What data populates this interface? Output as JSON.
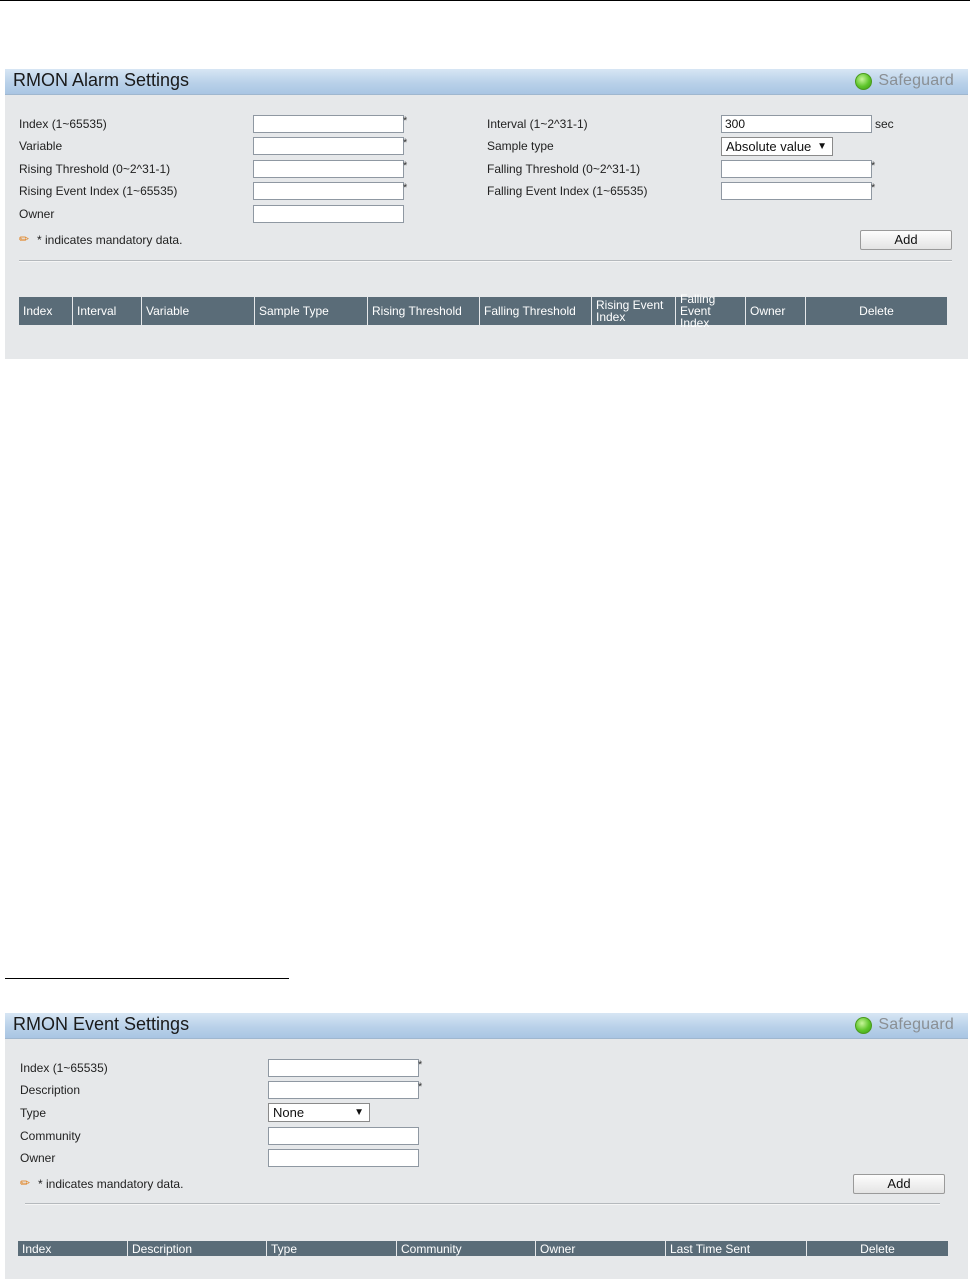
{
  "alarm": {
    "title": "RMON Alarm Settings",
    "safeguard": "Safeguard",
    "fields": {
      "index_label": "Index (1~65535)",
      "variable_label": "Variable",
      "rising_threshold_label": "Rising Threshold (0~2^31-1)",
      "rising_event_label": "Rising Event Index (1~65535)",
      "owner_label": "Owner",
      "interval_label": "Interval (1~2^31-1)",
      "interval_value": "300",
      "interval_unit": "sec",
      "sample_type_label": "Sample type",
      "sample_type_value": "Absolute value",
      "falling_threshold_label": "Falling Threshold (0~2^31-1)",
      "falling_event_label": "Falling Event Index (1~65535)"
    },
    "asterisk": "*",
    "mandatory_note": "* indicates mandatory data.",
    "add_label": "Add",
    "columns": [
      "Index",
      "Interval",
      "Variable",
      "Sample Type",
      "Rising Threshold",
      "Falling Threshold",
      "Rising Event Index",
      "Falling Event Index",
      "Owner",
      "Delete"
    ]
  },
  "event": {
    "title": "RMON Event Settings",
    "safeguard": "Safeguard",
    "fields": {
      "index_label": "Index (1~65535)",
      "description_label": "Description",
      "type_label": "Type",
      "type_value": "None",
      "community_label": "Community",
      "owner_label": "Owner"
    },
    "asterisk": "*",
    "mandatory_note": "* indicates mandatory data.",
    "add_label": "Add",
    "columns": [
      "Index",
      "Description",
      "Type",
      "Community",
      "Owner",
      "Last Time Sent",
      "Delete"
    ]
  }
}
